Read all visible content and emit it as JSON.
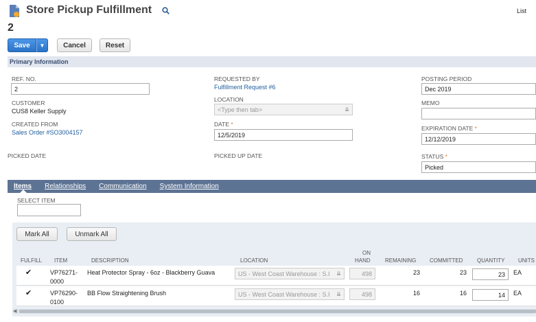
{
  "header": {
    "title": "Store Pickup Fulfillment",
    "record_number": "2",
    "list_link": "List"
  },
  "toolbar": {
    "save_label": "Save",
    "cancel_label": "Cancel",
    "reset_label": "Reset"
  },
  "section": {
    "primary_title": "Primary Information"
  },
  "fields": {
    "ref_no_label": "REF. NO.",
    "ref_no_value": "2",
    "customer_label": "CUSTOMER",
    "customer_value": "CUS8 Keller Supply",
    "created_from_label": "CREATED FROM",
    "created_from_value": "Sales Order #SO3004157",
    "picked_date_label": "PICKED DATE",
    "requested_by_label": "REQUESTED BY",
    "requested_by_value": "Fulfillment Request #6",
    "location_label": "LOCATION",
    "location_placeholder": "<Type then tab>",
    "date_label": "DATE",
    "date_value": "12/5/2019",
    "picked_up_date_label": "PICKED UP DATE",
    "posting_period_label": "POSTING PERIOD",
    "posting_period_value": "Dec 2019",
    "memo_label": "MEMO",
    "memo_value": "",
    "expiration_date_label": "EXPIRATION DATE",
    "expiration_date_value": "12/12/2019",
    "status_label": "STATUS",
    "status_value": "Picked",
    "required_mark": "*"
  },
  "tabs": [
    {
      "label": "Items"
    },
    {
      "label": "Relationships"
    },
    {
      "label": "Communication"
    },
    {
      "label": "System Information"
    }
  ],
  "items": {
    "select_item_label": "SELECT ITEM",
    "mark_all_label": "Mark All",
    "unmark_all_label": "Unmark All",
    "columns": {
      "fulfill": "FULFILL",
      "item": "ITEM",
      "description": "DESCRIPTION",
      "location": "LOCATION",
      "on_hand_1": "ON",
      "on_hand_2": "HAND",
      "remaining": "REMAINING",
      "committed": "COMMITTED",
      "quantity": "QUANTITY",
      "units": "UNITS"
    },
    "rows": [
      {
        "fulfill": "✔",
        "item_1": "VP76271-",
        "item_2": "0000",
        "description": "Heat Protector Spray - 6oz - Blackberry Guava",
        "location": "US - West Coast Warehouse : S.I",
        "on_hand": "498",
        "remaining": "23",
        "committed": "23",
        "quantity": "23",
        "units": "EA"
      },
      {
        "fulfill": "✔",
        "item_1": "VP76290-",
        "item_2": "0100",
        "description": "BB Flow Straightening Brush",
        "location": "US - West Coast Warehouse : S.I",
        "on_hand": "498",
        "remaining": "16",
        "committed": "16",
        "quantity": "14",
        "units": "EA"
      }
    ]
  }
}
